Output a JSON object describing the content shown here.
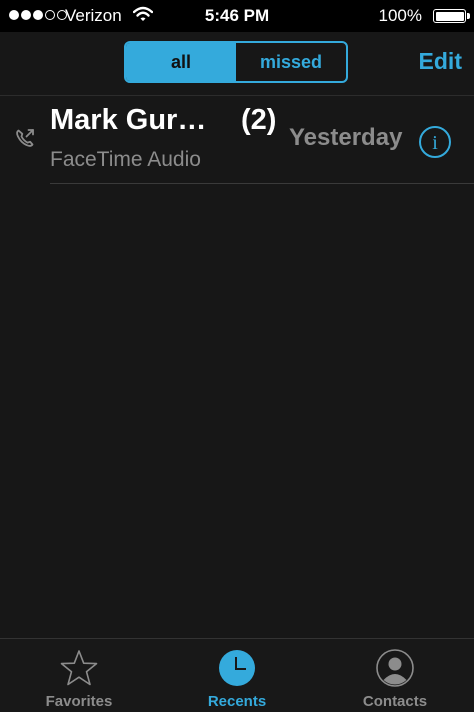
{
  "status_bar": {
    "carrier": "Verizon",
    "time": "5:46 PM",
    "battery": "100%",
    "signal_bars_filled": 3,
    "signal_bars_total": 5
  },
  "nav": {
    "segments": [
      "all",
      "missed"
    ],
    "active_segment": "all",
    "edit_label": "Edit"
  },
  "recents": [
    {
      "name": "Mark Gur…",
      "count": "(2)",
      "type": "FaceTime Audio",
      "date": "Yesterday"
    }
  ],
  "tab_bar": {
    "tabs": [
      {
        "label": "Favorites",
        "icon": "star-icon"
      },
      {
        "label": "Recents",
        "icon": "clock-icon"
      },
      {
        "label": "Contacts",
        "icon": "contacts-icon"
      }
    ],
    "active_tab": "Recents"
  },
  "colors": {
    "accent": "#34aadc",
    "background": "#171717",
    "secondary_text": "#8c8c8c"
  }
}
